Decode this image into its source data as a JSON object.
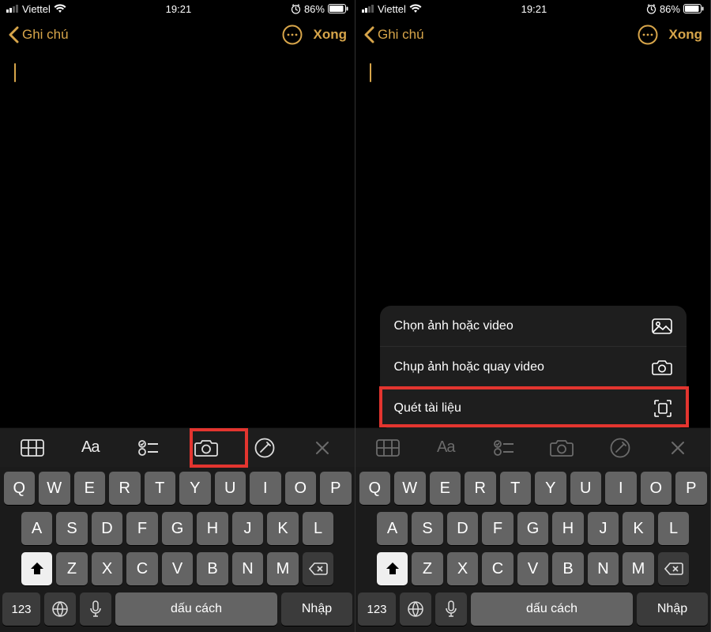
{
  "status": {
    "carrier": "Viettel",
    "time": "19:21",
    "battery": "86%"
  },
  "nav": {
    "back_label": "Ghi chú",
    "done_label": "Xong"
  },
  "popup": {
    "item1": "Chọn ảnh hoặc video",
    "item2": "Chụp ảnh hoặc quay video",
    "item3": "Quét tài liệu"
  },
  "toolbar": {
    "aa": "Aa"
  },
  "keyboard": {
    "row1": [
      "Q",
      "W",
      "E",
      "R",
      "T",
      "Y",
      "U",
      "I",
      "O",
      "P"
    ],
    "row2": [
      "A",
      "S",
      "D",
      "F",
      "G",
      "H",
      "J",
      "K",
      "L"
    ],
    "row3": [
      "Z",
      "X",
      "C",
      "V",
      "B",
      "N",
      "M"
    ],
    "num": "123",
    "space": "dấu cách",
    "enter": "Nhập"
  },
  "colors": {
    "accent": "#d7a54a",
    "highlight": "#e3352f"
  }
}
